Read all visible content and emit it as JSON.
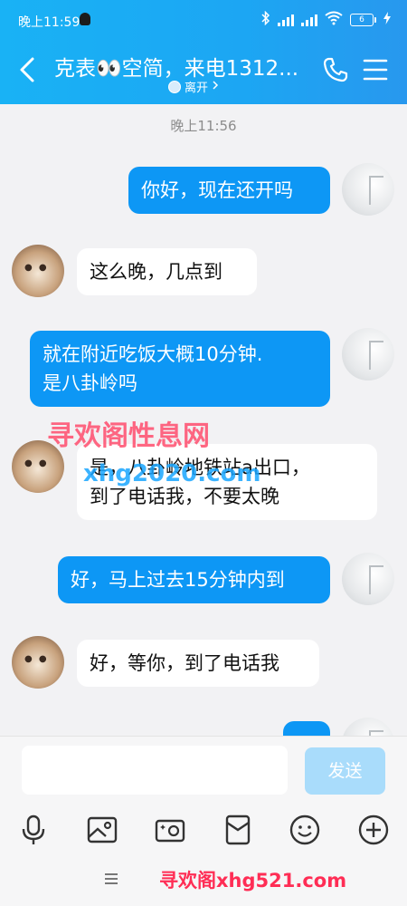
{
  "status": {
    "time": "晚上11:59",
    "battery": "6"
  },
  "header": {
    "title": "克表👀空简，来电1312...",
    "presence": "离开"
  },
  "messages": {
    "time_label": "晚上11:56",
    "m1": "你好，现在还开吗",
    "m2": "这么晚，几点到",
    "m3": "就在附近吃饭大概10分钟.\n是八卦岭吗",
    "m4": "是，八卦岭地铁站a出口，\n到了电话我，不要太晚",
    "m5": "好，马上过去15分钟内到",
    "m6": "好，等你，到了电话我"
  },
  "watermarks": {
    "w1": "寻欢阁性息网",
    "w2": "xhg2020.com",
    "w3": "寻欢阁xhg521.com"
  },
  "input": {
    "placeholder": "",
    "send_label": "发送"
  },
  "colors": {
    "header": "#1ca6f3",
    "bubble_self": "#0d97f5",
    "bubble_peer": "#ffffff",
    "send_disabled": "#a9dcfb"
  },
  "toolbar_icons": [
    "microphone-icon",
    "image-icon",
    "camera-icon",
    "red-packet-icon",
    "emoji-icon",
    "plus-icon"
  ]
}
